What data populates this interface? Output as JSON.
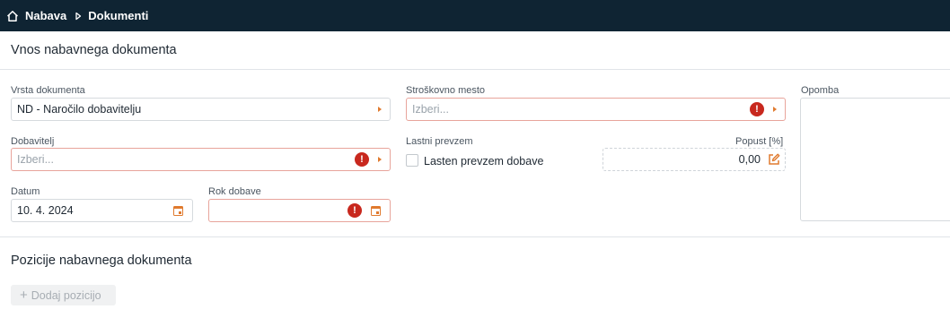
{
  "breadcrumb": {
    "home_icon": "home-icon",
    "items": [
      "Nabava",
      "Dokumenti"
    ],
    "separator_icon": "caret-right-icon"
  },
  "page": {
    "title": "Vnos nabavnega dokumenta"
  },
  "form": {
    "document_type": {
      "label": "Vrsta dokumenta",
      "value": "ND - Naročilo dobavitelju"
    },
    "supplier": {
      "label": "Dobavitelj",
      "placeholder": "Izberi..."
    },
    "date": {
      "label": "Datum",
      "value": "10. 4. 2024"
    },
    "delivery_deadline": {
      "label": "Rok dobave",
      "value": ""
    },
    "cost_center": {
      "label": "Stroškovno mesto",
      "placeholder": "Izberi..."
    },
    "own_pickup": {
      "label": "Lastni prevzem",
      "checkbox_label": "Lasten prevzem dobave",
      "checked": false
    },
    "discount": {
      "label": "Popust [%]",
      "value": "0,00"
    },
    "note": {
      "label": "Opomba",
      "value": ""
    },
    "error_mark": "!"
  },
  "positions": {
    "title": "Pozicije nabavnega dokumenta",
    "add_label": "Dodaj pozicijo",
    "add_icon": "+"
  },
  "colors": {
    "topbar": "#0f2433",
    "accent": "#e07a2e",
    "error": "#c8281e",
    "error_border": "#e8a49b"
  }
}
